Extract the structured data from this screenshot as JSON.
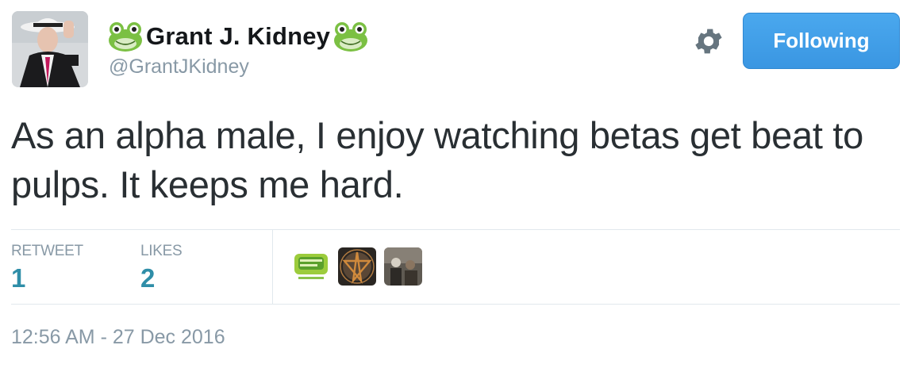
{
  "tweet": {
    "display_name": "Grant J. Kidney",
    "handle": "@GrantJKidney",
    "text": "As an alpha male, I enjoy watching betas get beat to pulps. It keeps me hard.",
    "follow_button_label": "Following",
    "timestamp": "12:56 AM - 27 Dec 2016"
  },
  "stats": {
    "retweet_label": "RETWEET",
    "retweet_count": "1",
    "likes_label": "LIKES",
    "likes_count": "2"
  },
  "icons": {
    "name_emoji": "frog-emoji-icon",
    "settings": "gear-icon"
  },
  "colors": {
    "follow_button": "#3a96e2",
    "stat_value": "#2f8ea8",
    "secondary_text": "#8899a6",
    "frog_green": "#7bc043"
  }
}
